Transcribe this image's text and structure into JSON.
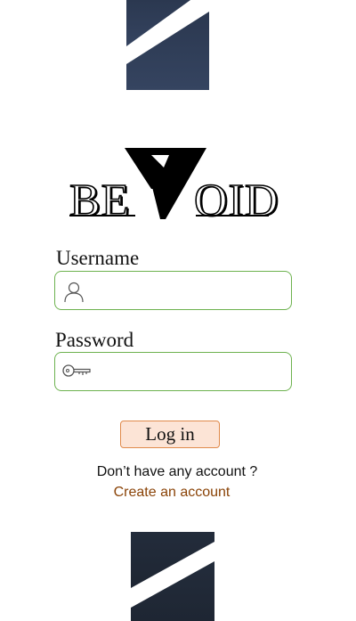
{
  "logo": {
    "left_text": "BE",
    "right_text": "OID"
  },
  "username": {
    "label": "Username",
    "value": "",
    "placeholder": ""
  },
  "password": {
    "label": "Password",
    "value": "",
    "placeholder": ""
  },
  "login_button": {
    "label": "Log in"
  },
  "signup": {
    "prompt": "Don’t have any account ?",
    "link_label": "Create an account"
  },
  "icons": {
    "username": "user-icon",
    "password": "key-icon"
  },
  "colors": {
    "deco_navy": "#2d3a52",
    "field_border": "#6db24f",
    "button_bg": "#fce4d6",
    "button_border": "#e08a4b",
    "link": "#8a4307"
  }
}
